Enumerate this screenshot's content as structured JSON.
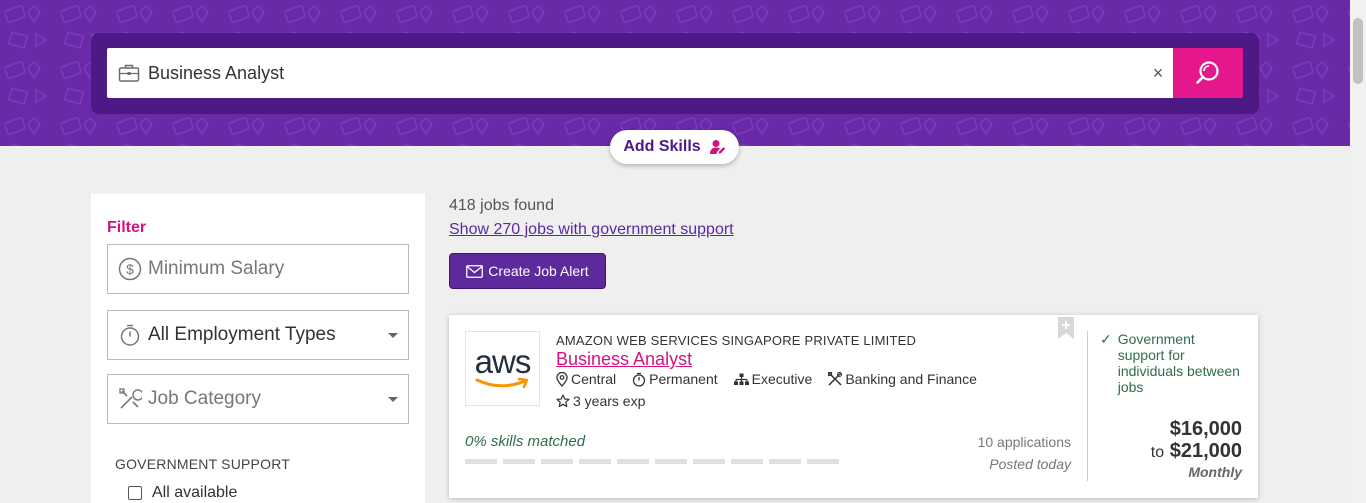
{
  "search": {
    "query": "Business Analyst",
    "clear_label": "×",
    "search_icon": "search-icon",
    "briefcase_icon": "briefcase-icon"
  },
  "add_skills": {
    "label": "Add Skills",
    "icon": "user-edit-icon"
  },
  "filter": {
    "title": "Filter",
    "min_salary_placeholder": "Minimum Salary",
    "employment_type_value": "All Employment Types",
    "job_category_placeholder": "Job Category",
    "gov_support_heading": "GOVERNMENT SUPPORT",
    "gov_support_option": "All available"
  },
  "results": {
    "count_text": "418 jobs found",
    "gov_link": "Show 270 jobs with government support",
    "create_alert_label": "Create Job Alert"
  },
  "job": {
    "company": "AMAZON WEB SERVICES SINGAPORE PRIVATE LIMITED",
    "title": "Business Analyst",
    "logo_text": "aws",
    "location": "Central",
    "employment": "Permanent",
    "level": "Executive",
    "category": "Banking and Finance",
    "experience": "3 years exp",
    "skills_matched": "0% skills matched",
    "applications": "10 applications",
    "posted": "Posted today",
    "gov_support_text": "Government support for individuals between jobs",
    "gov_support_tick": "✓",
    "salary_min": "$16,000",
    "salary_to": "to",
    "salary_max": "$21,000",
    "salary_period": "Monthly",
    "skill_bar_count": 10,
    "skill_bar_filled": 0
  },
  "colors": {
    "brand_purple": "#6a2aa8",
    "brand_dark_purple": "#4d1a85",
    "accent_pink": "#e4178c",
    "support_green": "#2f6e4a"
  }
}
